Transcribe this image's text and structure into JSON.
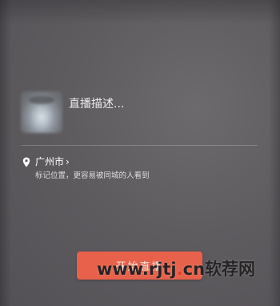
{
  "live_setup": {
    "description_placeholder": "直播描述...",
    "location": {
      "city": "广州市",
      "chevron": "›",
      "hint": "标记位置，更容易被同城的人看到"
    },
    "start_button_label": "开始直播"
  },
  "watermark": {
    "text_before_dot": "www.rjtj",
    "dot_text": ".",
    "text_after_dot": "cn软荐网"
  },
  "colors": {
    "start_button": "#e8614a",
    "background": "#5f5c60",
    "watermark_dot": "#e33a2a"
  },
  "icons": {
    "location": "location-pin-icon",
    "chevron": "chevron-right-icon"
  }
}
